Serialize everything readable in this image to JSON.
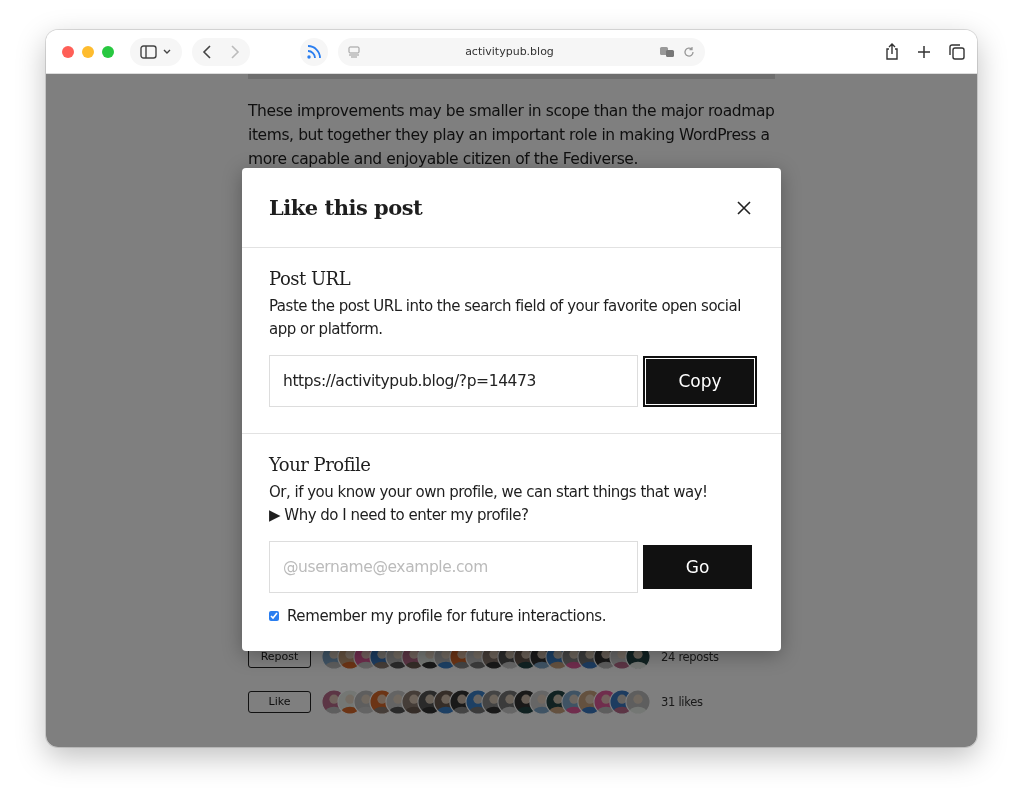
{
  "browser": {
    "address": "activitypub.blog"
  },
  "article": {
    "paragraph": "These improvements may be smaller in scope than the major roadmap items, but together they play an important role in making WordPress a more capable and enjoyable citizen of the Fediverse.",
    "reactions": [
      {
        "button": "Repost",
        "count": "24 reposts"
      },
      {
        "button": "Like",
        "count": "31 likes"
      }
    ]
  },
  "modal": {
    "title": "Like this post",
    "post_url": {
      "heading": "Post URL",
      "description": "Paste the post URL into the search field of your favorite open social app or platform.",
      "value": "https://activitypub.blog/?p=14473",
      "button": "Copy"
    },
    "profile": {
      "heading": "Your Profile",
      "description": "Or, if you know your own profile, we can start things that way!",
      "disclosure_icon": "▶",
      "disclosure": "Why do I need to enter my profile?",
      "placeholder": "@username@example.com",
      "button": "Go",
      "remember": {
        "label": "Remember my profile for future interactions.",
        "checked": true
      }
    }
  }
}
